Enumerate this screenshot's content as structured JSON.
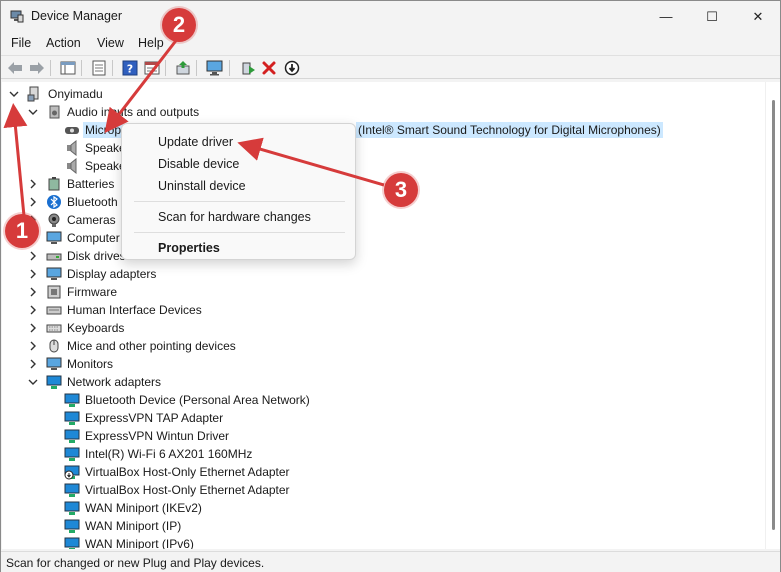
{
  "window": {
    "title": "Device Manager",
    "minimize": "—",
    "maximize": "☐",
    "close": "✕"
  },
  "menu": [
    "File",
    "Action",
    "View",
    "Help"
  ],
  "toolbar_icons": [
    "back-arrow-icon",
    "forward-arrow-icon",
    "show-hide-console-tree-icon",
    "properties-icon",
    "help-icon",
    "view-pane-icon",
    "update-driver-icon",
    "scan-hardware-icon",
    "enable-device-icon",
    "uninstall-icon",
    "disable-icon"
  ],
  "tree": {
    "root": "Onyimadu",
    "audio_category": "Audio inputs and outputs",
    "audio_children": [
      "Microphone Array (Intel® Smart Sound Technology for Digital Microphones)",
      "Speakers",
      "Speakers"
    ],
    "categories_top": [
      "Batteries",
      "Bluetooth",
      "Cameras",
      "Computer",
      "Disk drives",
      "Display adapters",
      "Firmware",
      "Human Interface Devices",
      "Keyboards",
      "Mice and other pointing devices",
      "Monitors"
    ],
    "network_category": "Network adapters",
    "network_children": [
      "Bluetooth Device (Personal Area Network)",
      "ExpressVPN TAP Adapter",
      "ExpressVPN Wintun Driver",
      "Intel(R) Wi-Fi 6 AX201 160MHz",
      "VirtualBox Host-Only Ethernet Adapter",
      "VirtualBox Host-Only Ethernet Adapter",
      "WAN Miniport (IKEv2)",
      "WAN Miniport (IP)",
      "WAN Miniport (IPv6)"
    ],
    "visible_partial": {
      "microphone": "Microp",
      "microphone_tail": "(Intel® Smart Sound Technology for Digital Microphones)",
      "speakers": "Speake",
      "bluetooth": "Bluetooth",
      "computer": "Computer"
    }
  },
  "context_menu": {
    "items": [
      "Update driver",
      "Disable device",
      "Uninstall device",
      "Scan for hardware changes",
      "Properties"
    ]
  },
  "status": "Scan for changed or new Plug and Play devices.",
  "annotations": [
    "1",
    "2",
    "3"
  ],
  "colors": {
    "selection": "#cce8ff",
    "annotation": "#d63b3b",
    "network_icon": "#1e88d6"
  }
}
